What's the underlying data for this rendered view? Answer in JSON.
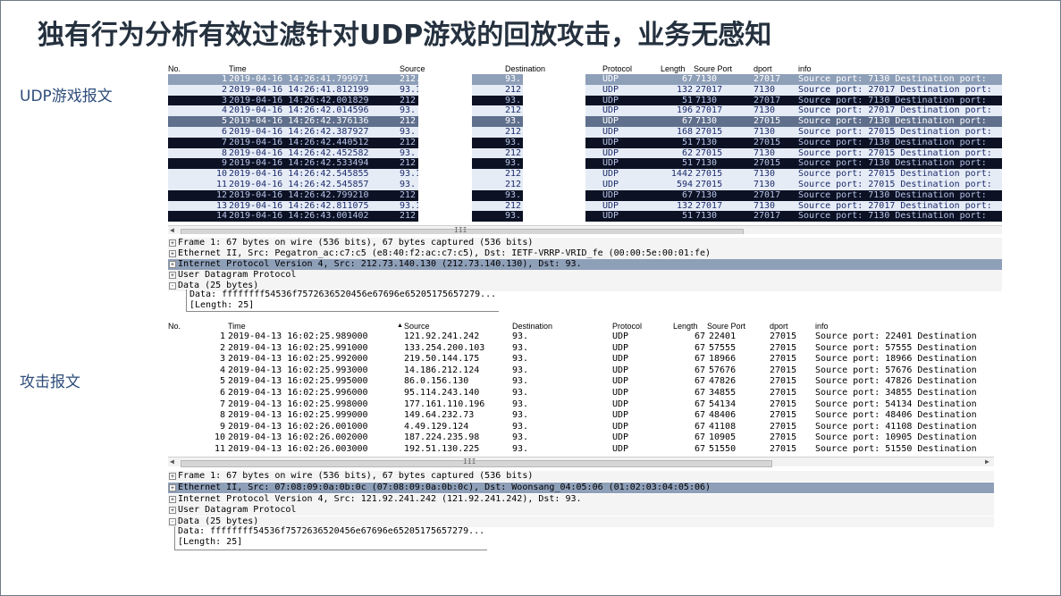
{
  "slide": {
    "title": "独有行为分析有效过滤针对UDP游戏的回放攻击，业务无感知",
    "label_top": "UDP游戏报文",
    "label_bottom": "攻击报文"
  },
  "top_capture": {
    "headers": {
      "no": "No.",
      "time": "Time",
      "source": "Source",
      "destination": "Destination",
      "protocol": "Protocol",
      "length": "Length",
      "sport": "Soure Port",
      "dport": "dport",
      "info": "info"
    },
    "rows": [
      {
        "no": "1",
        "time": "2019-04-16 14:26:41.799971",
        "source": "212.",
        "destination": "93.",
        "protocol": "UDP",
        "length": "67",
        "sport": "7130",
        "dport": "27017",
        "info": "Source port: 7130  Destination port:",
        "style": "selected"
      },
      {
        "no": "2",
        "time": "2019-04-16 14:26:41.812199",
        "source": "93.1",
        "destination": "212",
        "protocol": "UDP",
        "length": "132",
        "sport": "27017",
        "dport": "7130",
        "info": "Source port: 27017  Destination port:",
        "style": "light"
      },
      {
        "no": "3",
        "time": "2019-04-16 14:26:42.001829",
        "source": "212",
        "destination": "93.",
        "protocol": "UDP",
        "length": "51",
        "sport": "7130",
        "dport": "27017",
        "info": "Source port: 7130  Destination port:",
        "style": "dark"
      },
      {
        "no": "4",
        "time": "2019-04-16 14:26:42.014596",
        "source": "93.",
        "destination": "212",
        "protocol": "UDP",
        "length": "196",
        "sport": "27017",
        "dport": "7130",
        "info": "Source port: 27017  Destination port:",
        "style": "light"
      },
      {
        "no": "5",
        "time": "2019-04-16 14:26:42.376136",
        "source": "212",
        "destination": "93.",
        "protocol": "UDP",
        "length": "67",
        "sport": "7130",
        "dport": "27015",
        "info": "Source port: 7130  Destination port:",
        "style": "mid"
      },
      {
        "no": "6",
        "time": "2019-04-16 14:26:42.387927",
        "source": "93.",
        "destination": "212",
        "protocol": "UDP",
        "length": "168",
        "sport": "27015",
        "dport": "7130",
        "info": "Source port: 27015  Destination port:",
        "style": "light"
      },
      {
        "no": "7",
        "time": "2019-04-16 14:26:42.440512",
        "source": "212",
        "destination": "93.",
        "protocol": "UDP",
        "length": "51",
        "sport": "7130",
        "dport": "27015",
        "info": "Source port: 7130  Destination port:",
        "style": "dark"
      },
      {
        "no": "8",
        "time": "2019-04-16 14:26:42.452582",
        "source": "93.",
        "destination": "212",
        "protocol": "UDP",
        "length": "62",
        "sport": "27015",
        "dport": "7130",
        "info": "Source port: 27015  Destination port:",
        "style": "light"
      },
      {
        "no": "9",
        "time": "2019-04-16 14:26:42.533494",
        "source": "212",
        "destination": "93.",
        "protocol": "UDP",
        "length": "51",
        "sport": "7130",
        "dport": "27015",
        "info": "Source port: 7130  Destination port:",
        "style": "dark"
      },
      {
        "no": "10",
        "time": "2019-04-16 14:26:42.545855",
        "source": "93.1",
        "destination": "212",
        "protocol": "UDP",
        "length": "1442",
        "sport": "27015",
        "dport": "7130",
        "info": "Source port: 27015  Destination port:",
        "style": "light"
      },
      {
        "no": "11",
        "time": "2019-04-16 14:26:42.545857",
        "source": "93.",
        "destination": "212",
        "protocol": "UDP",
        "length": "594",
        "sport": "27015",
        "dport": "7130",
        "info": "Source port: 27015  Destination port:",
        "style": "light"
      },
      {
        "no": "12",
        "time": "2019-04-16 14:26:42.799210",
        "source": "212",
        "destination": "93.",
        "protocol": "UDP",
        "length": "67",
        "sport": "7130",
        "dport": "27017",
        "info": "Source port: 7130  Destination port:",
        "style": "dark"
      },
      {
        "no": "13",
        "time": "2019-04-16 14:26:42.811075",
        "source": "93.1",
        "destination": "212",
        "protocol": "UDP",
        "length": "132",
        "sport": "27017",
        "dport": "7130",
        "info": "Source port: 27017  Destination port:",
        "style": "light"
      },
      {
        "no": "14",
        "time": "2019-04-16 14:26:43.001402",
        "source": "212",
        "destination": "93.",
        "protocol": "UDP",
        "length": "51",
        "sport": "7130",
        "dport": "27017",
        "info": "Source port: 7130  Destination port:",
        "style": "dark"
      }
    ],
    "details": [
      {
        "expander": "+",
        "text": "Frame 1: 67 bytes on wire (536 bits), 67 bytes captured (536 bits)",
        "highlight": false
      },
      {
        "expander": "+",
        "text": "Ethernet II, Src: Pegatron_ac:c7:c5 (e8:40:f2:ac:c7:c5), Dst: IETF-VRRP-VRID_fe (00:00:5e:00:01:fe)",
        "highlight": false
      },
      {
        "expander": "+",
        "text": "Internet Protocol Version 4, Src: 212.73.140.130 (212.73.140.130), Dst: 93.",
        "highlight": true
      },
      {
        "expander": "+",
        "text": "User Datagram Protocol",
        "highlight": false
      },
      {
        "expander": "-",
        "text": "Data (25 bytes)",
        "highlight": false
      }
    ],
    "data_box": [
      "Data: ffffffff54536f7572636520456e67696e65205175657279...",
      "[Length: 25]"
    ]
  },
  "bottom_capture": {
    "headers": {
      "no": "No.",
      "time": "Time",
      "source": "Source",
      "destination": "Destination",
      "protocol": "Protocol",
      "length": "Length",
      "sport": "Soure Port",
      "dport": "dport",
      "info": "info"
    },
    "sort_arrow": "▲",
    "rows": [
      {
        "no": "1",
        "time": "2019-04-13 16:02:25.989000",
        "source": "121.92.241.242",
        "destination": "93.",
        "protocol": "UDP",
        "length": "67",
        "sport": "22401",
        "dport": "27015",
        "info": "Source port: 22401  Destination"
      },
      {
        "no": "2",
        "time": "2019-04-13 16:02:25.991000",
        "source": "133.254.200.103",
        "destination": "93.",
        "protocol": "UDP",
        "length": "67",
        "sport": "57555",
        "dport": "27015",
        "info": "Source port: 57555  Destination"
      },
      {
        "no": "3",
        "time": "2019-04-13 16:02:25.992000",
        "source": "219.50.144.175",
        "destination": "93.",
        "protocol": "UDP",
        "length": "67",
        "sport": "18966",
        "dport": "27015",
        "info": "Source port: 18966  Destination"
      },
      {
        "no": "4",
        "time": "2019-04-13 16:02:25.993000",
        "source": "14.186.212.124",
        "destination": "93.",
        "protocol": "UDP",
        "length": "67",
        "sport": "57676",
        "dport": "27015",
        "info": "Source port: 57676  Destination"
      },
      {
        "no": "5",
        "time": "2019-04-13 16:02:25.995000",
        "source": "86.0.156.130",
        "destination": "93.",
        "protocol": "UDP",
        "length": "67",
        "sport": "47826",
        "dport": "27015",
        "info": "Source port: 47826  Destination"
      },
      {
        "no": "6",
        "time": "2019-04-13 16:02:25.996000",
        "source": "95.114.243.140",
        "destination": "93.",
        "protocol": "UDP",
        "length": "67",
        "sport": "34855",
        "dport": "27015",
        "info": "Source port: 34855  Destination"
      },
      {
        "no": "7",
        "time": "2019-04-13 16:02:25.998000",
        "source": "177.161.110.196",
        "destination": "93.",
        "protocol": "UDP",
        "length": "67",
        "sport": "54134",
        "dport": "27015",
        "info": "Source port: 54134  Destination"
      },
      {
        "no": "8",
        "time": "2019-04-13 16:02:25.999000",
        "source": "149.64.232.73",
        "destination": "93.",
        "protocol": "UDP",
        "length": "67",
        "sport": "48406",
        "dport": "27015",
        "info": "Source port: 48406  Destination"
      },
      {
        "no": "9",
        "time": "2019-04-13 16:02:26.001000",
        "source": "4.49.129.124",
        "destination": "93.",
        "protocol": "UDP",
        "length": "67",
        "sport": "41108",
        "dport": "27015",
        "info": "Source port: 41108  Destination"
      },
      {
        "no": "10",
        "time": "2019-04-13 16:02:26.002000",
        "source": "187.224.235.98",
        "destination": "93.",
        "protocol": "UDP",
        "length": "67",
        "sport": "10905",
        "dport": "27015",
        "info": "Source port: 10905  Destination"
      },
      {
        "no": "11",
        "time": "2019-04-13 16:02:26.003000",
        "source": "192.51.130.225",
        "destination": "93.",
        "protocol": "UDP",
        "length": "67",
        "sport": "51550",
        "dport": "27015",
        "info": "Source port: 51550  Destination"
      }
    ],
    "details": [
      {
        "expander": "+",
        "text": "Frame 1: 67 bytes on wire (536 bits), 67 bytes captured (536 bits)",
        "highlight": false
      },
      {
        "expander": "+",
        "text": "Ethernet II, Src: 07:08:09:0a:0b:0c (07:08:09:0a:0b:0c), Dst: Woonsang_04:05:06 (01:02:03:04:05:06)",
        "highlight": true
      },
      {
        "expander": "+",
        "text": "Internet Protocol Version 4, Src: 121.92.241.242 (121.92.241.242), Dst: 93.",
        "highlight": false
      },
      {
        "expander": "+",
        "text": "User Datagram Protocol",
        "highlight": false
      },
      {
        "expander": "-",
        "text": "Data (25 bytes)",
        "highlight": false
      }
    ],
    "data_box": [
      "Data: ffffffff54536f7572636520456e67696e65205175657279...",
      "[Length: 25]"
    ]
  },
  "colors": {
    "selected_bg": "#8e9fb8",
    "selected_fg": "#ffffff",
    "light_bg": "#e6ecf6",
    "light_fg": "#1a2a6a",
    "dark_bg": "#0c1224",
    "dark_fg": "#b8c4e8",
    "mid_bg": "#5f6f8c",
    "mid_fg": "#ffffff",
    "highlight_bg": "#8e9fb8"
  },
  "scroll_grip": "III"
}
